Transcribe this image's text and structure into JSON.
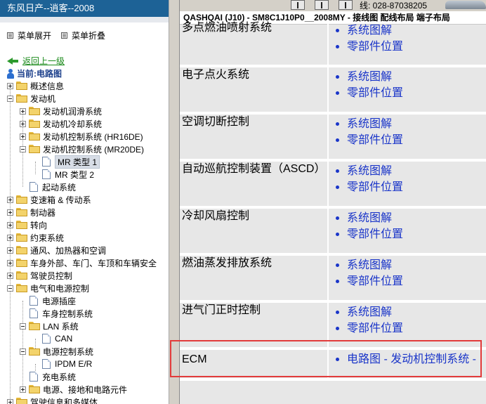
{
  "window": {
    "nav_title": "东风日产--逍客--2008",
    "page_title": "QASHQAI (J10) - SM8C1J10P0__2008MY - 接线图 配线布局 端子布局",
    "phone_text": "线: 028-87038205"
  },
  "nav": {
    "menu_expand": "菜单展开",
    "menu_collapse": "菜单折叠",
    "back_link": "返回上一级",
    "current_label": "当前:电路图",
    "tree": [
      {
        "label": "概述信息"
      },
      {
        "label": "发动机"
      },
      {
        "label": "发动机润滑系统"
      },
      {
        "label": "发动机冷却系统"
      },
      {
        "label": "发动机控制系统 (HR16DE)"
      },
      {
        "label": "发动机控制系统 (MR20DE)"
      },
      {
        "label": "MR 类型 1"
      },
      {
        "label": "MR 类型 2"
      },
      {
        "label": "起动系统"
      },
      {
        "label": "变速箱 & 传动系"
      },
      {
        "label": "制动器"
      },
      {
        "label": "转向"
      },
      {
        "label": "约束系统"
      },
      {
        "label": "通风、加热器和空调"
      },
      {
        "label": "车身外部、车门、车顶和车辆安全"
      },
      {
        "label": "驾驶员控制"
      },
      {
        "label": "电气和电源控制"
      },
      {
        "label": "电源插座"
      },
      {
        "label": "车身控制系统"
      },
      {
        "label": "LAN 系统"
      },
      {
        "label": "CAN"
      },
      {
        "label": "电源控制系统"
      },
      {
        "label": "IPDM E/R"
      },
      {
        "label": "充电系统"
      },
      {
        "label": "电源、接地和电路元件"
      },
      {
        "label": "驾驶信息和多媒体"
      }
    ]
  },
  "systems": [
    {
      "name": "多点燃油喷射系统",
      "links": [
        "系统图解",
        "零部件位置"
      ]
    },
    {
      "name": "电子点火系统",
      "links": [
        "系统图解",
        "零部件位置"
      ]
    },
    {
      "name": "空调切断控制",
      "links": [
        "系统图解",
        "零部件位置"
      ]
    },
    {
      "name": "自动巡航控制装置（ASCD）",
      "links": [
        "系统图解",
        "零部件位置"
      ]
    },
    {
      "name": "冷却风扇控制",
      "links": [
        "系统图解",
        "零部件位置"
      ]
    },
    {
      "name": "燃油蒸发排放系统",
      "links": [
        "系统图解",
        "零部件位置"
      ]
    },
    {
      "name": "进气门正时控制",
      "links": [
        "系统图解",
        "零部件位置"
      ]
    },
    {
      "name": "ECM",
      "links": [
        "电路图 - 发动机控制系统 -"
      ]
    }
  ],
  "colors": {
    "nav_title_bg": "#1d6296",
    "link": "#1a35c9",
    "highlight": "#e23b3b",
    "content_bg": "#e7e7e7"
  }
}
